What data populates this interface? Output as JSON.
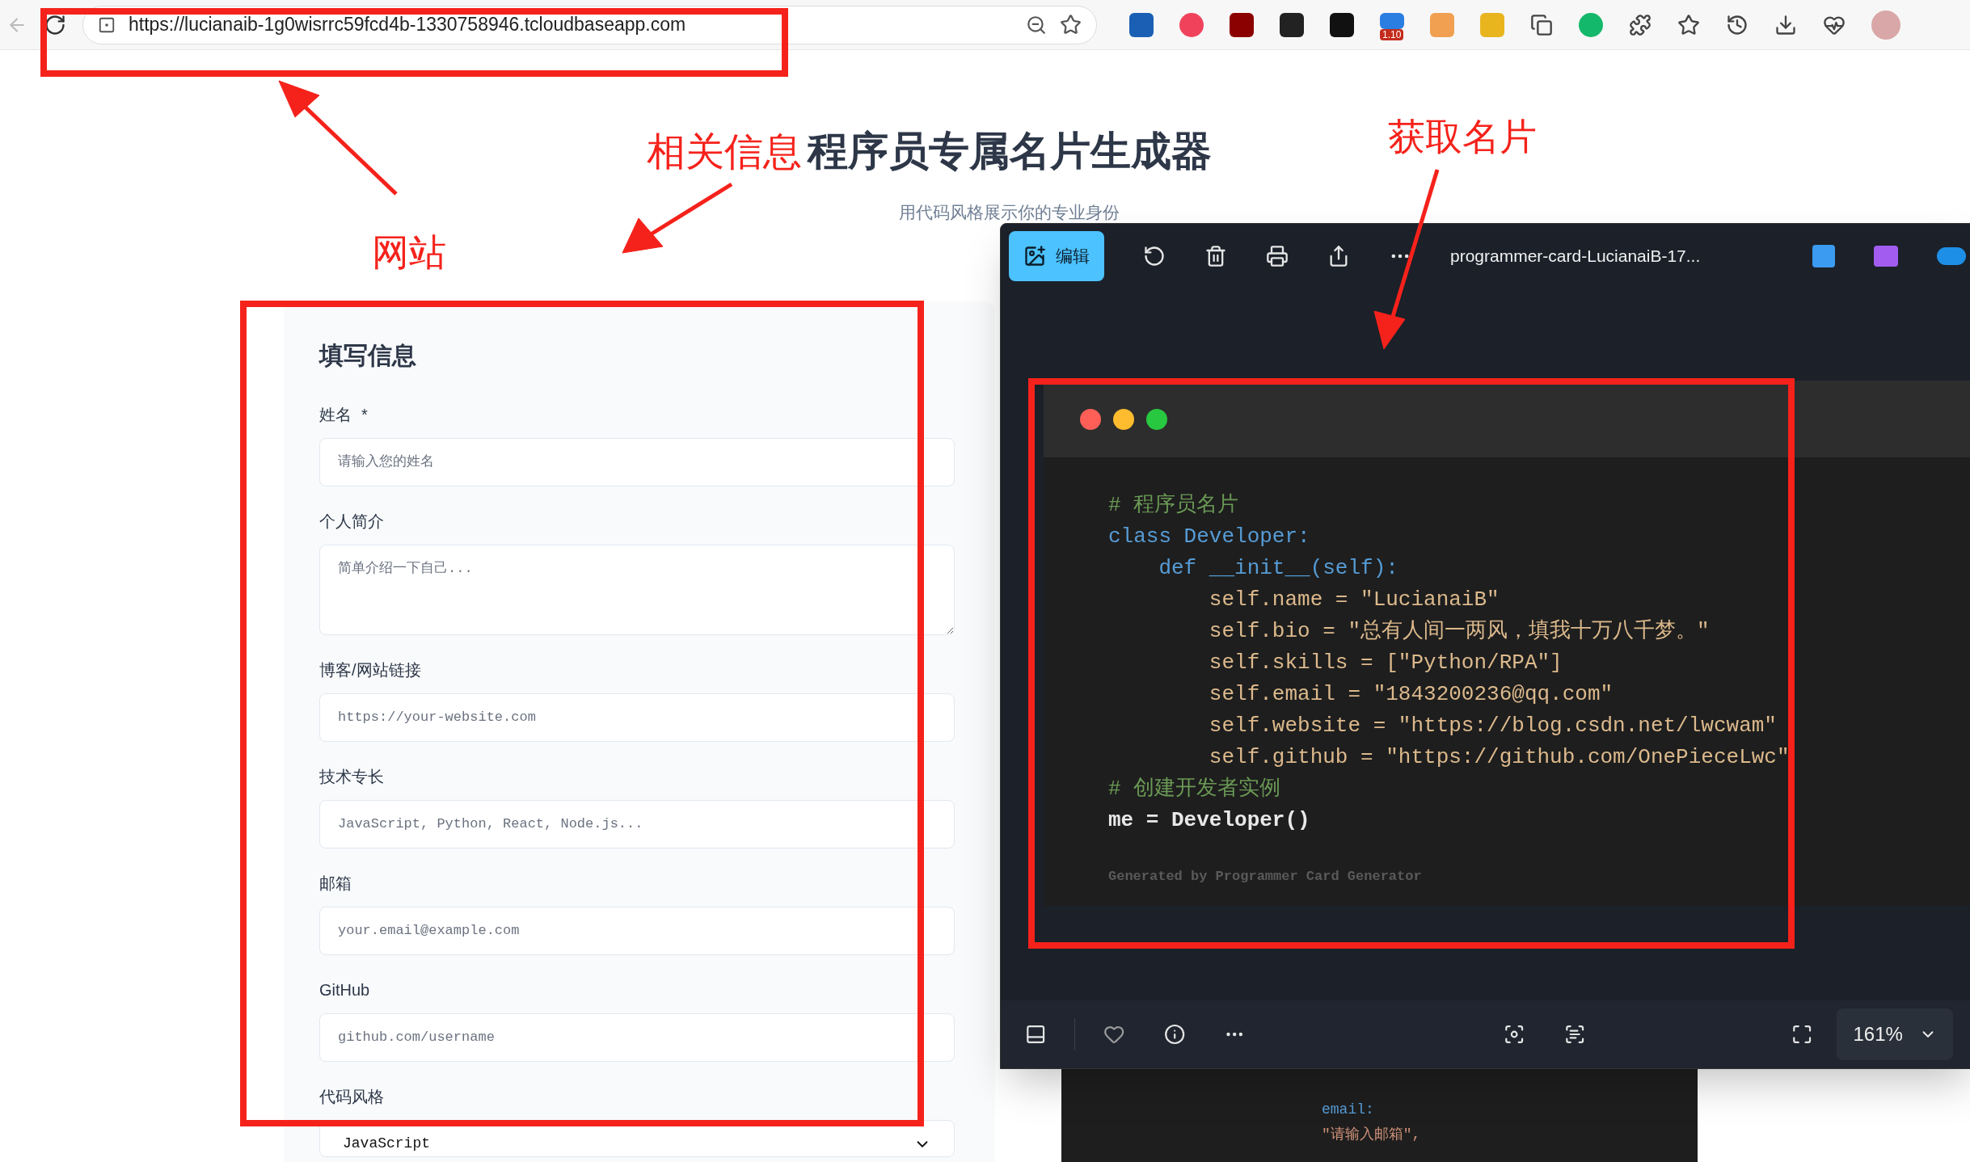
{
  "browser": {
    "url": "https://lucianaib-1g0wisrrc59fcd4b-1330758946.tcloudbaseapp.com",
    "extension_badge": "1.10"
  },
  "annotations": {
    "site_label": "网站",
    "info_label": "相关信息",
    "card_label": "获取名片"
  },
  "page": {
    "title": "程序员专属名片生成器",
    "subtitle": "用代码风格展示你的专业身份"
  },
  "form": {
    "heading": "填写信息",
    "fields": [
      {
        "kind": "input",
        "label": "姓名",
        "marker": "*",
        "placeholder": "请输入您的姓名"
      },
      {
        "kind": "textarea",
        "label": "个人简介",
        "placeholder": "简单介绍一下自己..."
      },
      {
        "kind": "input",
        "label": "博客/网站链接",
        "placeholder": "https://your-website.com"
      },
      {
        "kind": "input",
        "label": "技术专长",
        "placeholder": "JavaScript, Python, React, Node.js..."
      },
      {
        "kind": "input",
        "label": "邮箱",
        "placeholder": "your.email@example.com"
      },
      {
        "kind": "input",
        "label": "GitHub",
        "placeholder": "github.com/username"
      },
      {
        "kind": "select",
        "label": "代码风格",
        "value": "JavaScript"
      }
    ]
  },
  "viewer": {
    "edit_label": "编辑",
    "file_name": "programmer-card-LucianaiB-17...",
    "zoom": "161%",
    "footer": "Generated by Programmer Card Generator",
    "code_lines": [
      {
        "kind": "comment",
        "text": "# 程序员名片"
      },
      {
        "kind": "keyword",
        "text": "class Developer:"
      },
      {
        "kind": "keyword",
        "text": "    def __init__(self):"
      },
      {
        "kind": "attr",
        "text": "        self.name = \"LucianaiB\""
      },
      {
        "kind": "attr",
        "text": "        self.bio = \"总有人间一两风，填我十万八千梦。\""
      },
      {
        "kind": "attr",
        "text": "        self.skills = [\"Python/RPA\"]"
      },
      {
        "kind": "attr",
        "text": "        self.email = \"1843200236@qq.com\""
      },
      {
        "kind": "attr",
        "text": "        self.website = \"https://blog.csdn.net/lwcwam\""
      },
      {
        "kind": "attr",
        "text": "        self.github = \"https://github.com/OnePieceLwc\""
      },
      {
        "kind": "comment",
        "text": "# 创建开发者实例"
      },
      {
        "kind": "plain",
        "text": "me = Developer()"
      }
    ]
  },
  "behind_code": [
    {
      "kind": "keyword",
      "text": "email:"
    },
    {
      "kind": "string",
      "text": "\"请输入邮箱\","
    }
  ]
}
